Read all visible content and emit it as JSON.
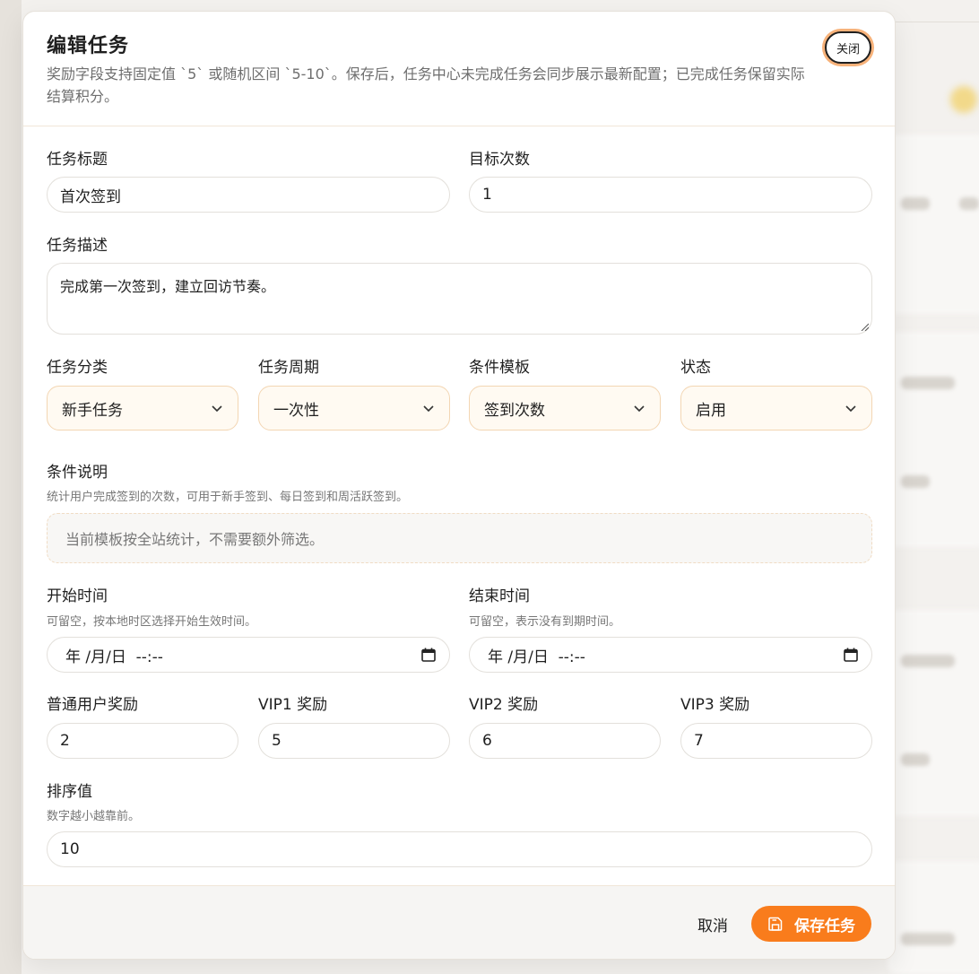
{
  "modal": {
    "title": "编辑任务",
    "subtitle": "奖励字段支持固定值 `5` 或随机区间 `5-10`。保存后，任务中心未完成任务会同步展示最新配置；已完成任务保留实际结算积分。",
    "close_label": "关闭"
  },
  "form": {
    "title": {
      "label": "任务标题",
      "value": "首次签到"
    },
    "target_count": {
      "label": "目标次数",
      "value": "1"
    },
    "description": {
      "label": "任务描述",
      "value": "完成第一次签到，建立回访节奏。"
    },
    "category": {
      "label": "任务分类",
      "value": "新手任务"
    },
    "period": {
      "label": "任务周期",
      "value": "一次性"
    },
    "condition_template": {
      "label": "条件模板",
      "value": "签到次数"
    },
    "status": {
      "label": "状态",
      "value": "启用"
    },
    "condition_desc": {
      "label": "条件说明",
      "hint": "统计用户完成签到的次数，可用于新手签到、每日签到和周活跃签到。",
      "note": "当前模板按全站统计，不需要额外筛选。"
    },
    "start_time": {
      "label": "开始时间",
      "hint": "可留空，按本地时区选择开始生效时间。",
      "placeholder": "年 /月/日  --:--"
    },
    "end_time": {
      "label": "结束时间",
      "hint": "可留空，表示没有到期时间。",
      "placeholder": "年 /月/日  --:--"
    },
    "reward_normal": {
      "label": "普通用户奖励",
      "value": "2"
    },
    "reward_vip1": {
      "label": "VIP1 奖励",
      "value": "5"
    },
    "reward_vip2": {
      "label": "VIP2 奖励",
      "value": "6"
    },
    "reward_vip3": {
      "label": "VIP3 奖励",
      "value": "7"
    },
    "sort": {
      "label": "排序值",
      "hint": "数字越小越靠前。",
      "value": "10"
    }
  },
  "footer": {
    "cancel_label": "取消",
    "save_label": "保存任务"
  },
  "colors": {
    "accent": "#f97c1c",
    "select_bg": "#fffaf2",
    "select_border": "#f3d6b3"
  },
  "icons": {
    "close": "close-button",
    "chevron": "chevron-down-icon",
    "calendar": "calendar-icon",
    "save": "save-icon"
  }
}
